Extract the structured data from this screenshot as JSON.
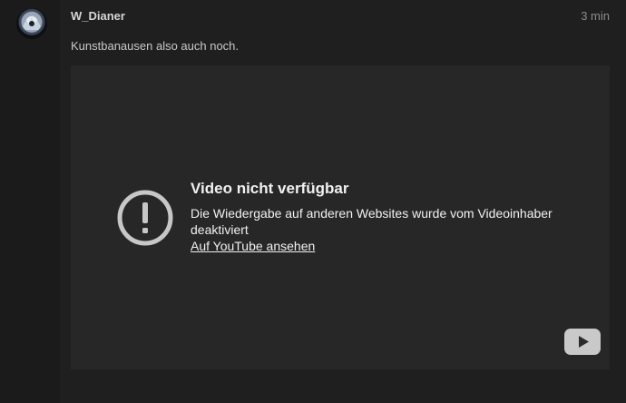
{
  "post": {
    "username": "W_Dianer",
    "timestamp": "3 min",
    "text": "Kunstbanausen also auch noch."
  },
  "video": {
    "title": "Video nicht verfügbar",
    "message": "Die Wiedergabe auf anderen Websites wurde vom Videoinhaber deaktiviert",
    "link_label": "Auf YouTube ansehen",
    "icons": {
      "warning": "exclamation-circle-icon",
      "logo": "youtube-logo-icon"
    }
  },
  "colors": {
    "page_background": "#1b1b1b",
    "post_background": "#1f1f1f",
    "video_background": "#272727",
    "text_primary": "#f1f1f1",
    "text_muted": "#8c8c8c"
  }
}
